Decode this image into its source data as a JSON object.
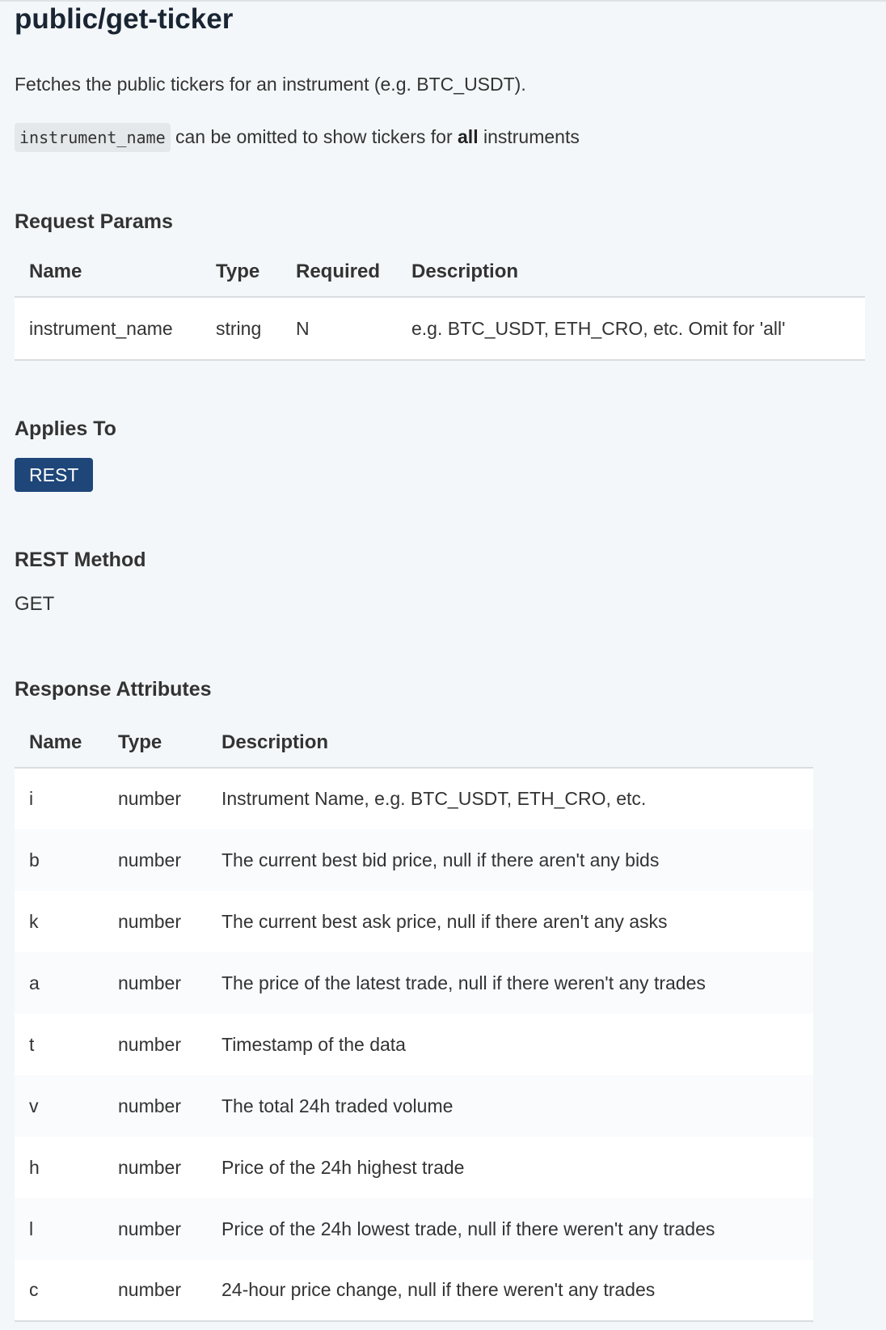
{
  "title": "public/get-ticker",
  "intro": "Fetches the public tickers for an instrument (e.g. BTC_USDT).",
  "note": {
    "code": "instrument_name",
    "text_before_bold": " can be omitted to show tickers for ",
    "bold": "all",
    "text_after_bold": " instruments"
  },
  "request_params": {
    "heading": "Request Params",
    "headers": [
      "Name",
      "Type",
      "Required",
      "Description"
    ],
    "rows": [
      [
        "instrument_name",
        "string",
        "N",
        "e.g. BTC_USDT, ETH_CRO, etc. Omit for 'all'"
      ]
    ]
  },
  "applies_to": {
    "heading": "Applies To",
    "badge": "REST"
  },
  "rest_method": {
    "heading": "REST Method",
    "value": "GET"
  },
  "response_attributes": {
    "heading": "Response Attributes",
    "headers": [
      "Name",
      "Type",
      "Description"
    ],
    "rows": [
      [
        "i",
        "number",
        "Instrument Name, e.g. BTC_USDT, ETH_CRO, etc."
      ],
      [
        "b",
        "number",
        "The current best bid price, null if there aren't any bids"
      ],
      [
        "k",
        "number",
        "The current best ask price, null if there aren't any asks"
      ],
      [
        "a",
        "number",
        "The price of the latest trade, null if there weren't any trades"
      ],
      [
        "t",
        "number",
        "Timestamp of the data"
      ],
      [
        "v",
        "number",
        "The total 24h traded volume"
      ],
      [
        "h",
        "number",
        "Price of the 24h highest trade"
      ],
      [
        "l",
        "number",
        "Price of the 24h lowest trade, null if there weren't any trades"
      ],
      [
        "c",
        "number",
        "24-hour price change, null if there weren't any trades"
      ]
    ]
  },
  "colors": {
    "badge_bg": "#1e4679",
    "title": "#1a2533",
    "page_bg": "#f3f7f9"
  }
}
